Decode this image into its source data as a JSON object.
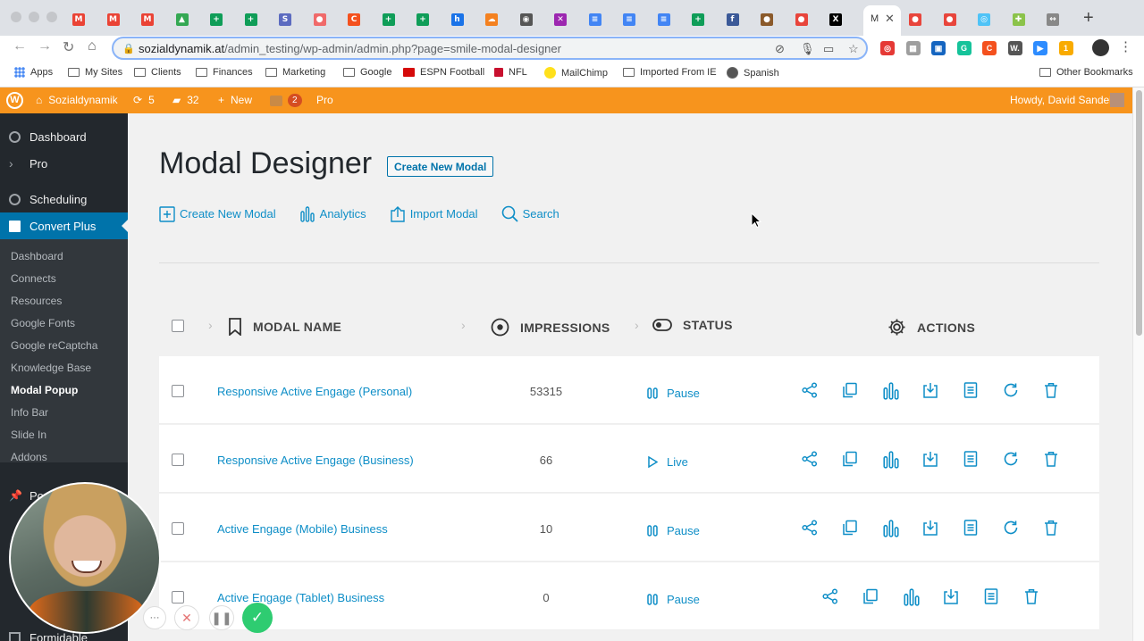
{
  "browser": {
    "url_domain": "sozialdynamik.at",
    "url_path": "/admin_testing/wp-admin/admin.php?page=smile-modal-designer",
    "active_tab_label": "M",
    "tab_favicons": [
      {
        "glyph": "M",
        "color": "#ea4335"
      },
      {
        "glyph": "M",
        "color": "#ea4335"
      },
      {
        "glyph": "M",
        "color": "#ea4335"
      },
      {
        "glyph": "▲",
        "color": "#34a853"
      },
      {
        "glyph": "+",
        "color": "#0f9d58"
      },
      {
        "glyph": "+",
        "color": "#0f9d58"
      },
      {
        "glyph": "S",
        "color": "#5c6bc0"
      },
      {
        "glyph": "●",
        "color": "#f06a6a"
      },
      {
        "glyph": "C",
        "color": "#f4511e"
      },
      {
        "glyph": "+",
        "color": "#0f9d58"
      },
      {
        "glyph": "+",
        "color": "#0f9d58"
      },
      {
        "glyph": "h",
        "color": "#1a73e8"
      },
      {
        "glyph": "☁",
        "color": "#f48120"
      },
      {
        "glyph": "◉",
        "color": "#555555"
      },
      {
        "glyph": "✕",
        "color": "#9c27b0"
      },
      {
        "glyph": "≡",
        "color": "#4285f4"
      },
      {
        "glyph": "≡",
        "color": "#4285f4"
      },
      {
        "glyph": "≡",
        "color": "#4285f4"
      },
      {
        "glyph": "+",
        "color": "#0f9d58"
      },
      {
        "glyph": "f",
        "color": "#3b5998"
      },
      {
        "glyph": "●",
        "color": "#8b5a2b"
      },
      {
        "glyph": "●",
        "color": "#e8453c"
      },
      {
        "glyph": "X",
        "color": "#000000"
      }
    ],
    "tab_favicons_right": [
      {
        "glyph": "●",
        "color": "#e8453c"
      },
      {
        "glyph": "●",
        "color": "#e8453c"
      },
      {
        "glyph": "◎",
        "color": "#4fc3f7"
      },
      {
        "glyph": "✚",
        "color": "#8bc34a"
      },
      {
        "glyph": "↔",
        "color": "#888888"
      }
    ],
    "extensions": [
      {
        "glyph": "◎",
        "color": "#e53935"
      },
      {
        "glyph": "▦",
        "color": "#9e9e9e"
      },
      {
        "glyph": "▣",
        "color": "#1565c0"
      },
      {
        "glyph": "G",
        "color": "#15c39a"
      },
      {
        "glyph": "C",
        "color": "#f4511e"
      },
      {
        "glyph": "W.",
        "color": "#555555"
      },
      {
        "glyph": "▶",
        "color": "#2d8cff"
      },
      {
        "glyph": "1",
        "color": "#f9ab00"
      }
    ]
  },
  "bookmarks": [
    {
      "label": "Apps",
      "icon": "apps-grid-icon"
    },
    {
      "label": "My Sites",
      "icon": "folder-icon"
    },
    {
      "label": "Clients",
      "icon": "folder-icon"
    },
    {
      "label": "Finances",
      "icon": "folder-icon"
    },
    {
      "label": "Marketing",
      "icon": "folder-icon"
    },
    {
      "label": "Google",
      "icon": "folder-icon"
    },
    {
      "label": "ESPN Football",
      "icon": "espn-icon"
    },
    {
      "label": "NFL",
      "icon": "nfl-icon"
    },
    {
      "label": "MailChimp",
      "icon": "mailchimp-icon"
    },
    {
      "label": "Imported From IE",
      "icon": "folder-icon"
    },
    {
      "label": "Spanish",
      "icon": "globe-icon"
    },
    {
      "label": "Other Bookmarks",
      "icon": "folder-icon"
    }
  ],
  "adminbar": {
    "site_name": "Sozialdynamik",
    "updates_count": "5",
    "comments_count": "32",
    "new_label": "New",
    "notifications_count": "2",
    "pro_label": "Pro",
    "howdy": "Howdy, David Sandel"
  },
  "sidebar": {
    "top_items": [
      {
        "label": "Dashboard"
      },
      {
        "label": "Pro"
      },
      {
        "label": "Scheduling"
      },
      {
        "label": "Convert Plus"
      }
    ],
    "submenu": [
      {
        "label": "Dashboard"
      },
      {
        "label": "Connects"
      },
      {
        "label": "Resources"
      },
      {
        "label": "Google Fonts"
      },
      {
        "label": "Google reCaptcha"
      },
      {
        "label": "Knowledge Base"
      },
      {
        "label": "Modal Popup"
      },
      {
        "label": "Info Bar"
      },
      {
        "label": "Slide In"
      },
      {
        "label": "Addons"
      }
    ],
    "lower_items": [
      {
        "label": "Po"
      },
      {
        "label": "Formidable"
      }
    ]
  },
  "page": {
    "title": "Modal Designer",
    "title_button": "Create New Modal",
    "actions": [
      {
        "label": "Create New Modal"
      },
      {
        "label": "Analytics"
      },
      {
        "label": "Import Modal"
      },
      {
        "label": "Search"
      }
    ]
  },
  "table": {
    "headers": {
      "name": "MODAL NAME",
      "impressions": "IMPRESSIONS",
      "status": "STATUS",
      "actions": "ACTIONS"
    },
    "rows": [
      {
        "name": "Responsive Active Engage (Personal)",
        "impressions": "53315",
        "status": "Pause"
      },
      {
        "name": "Responsive Active Engage (Business)",
        "impressions": "66",
        "status": "Live"
      },
      {
        "name": "Active Engage (Mobile) Business",
        "impressions": "10",
        "status": "Pause"
      },
      {
        "name": "Active Engage (Tablet) Business",
        "impressions": "0",
        "status": "Pause"
      }
    ]
  },
  "recorder": {
    "more": "···"
  },
  "colors": {
    "admin_bar": "#f7941d",
    "sidebar": "#23282d",
    "active_menu": "#0073aa",
    "link": "#0e8ec7"
  }
}
